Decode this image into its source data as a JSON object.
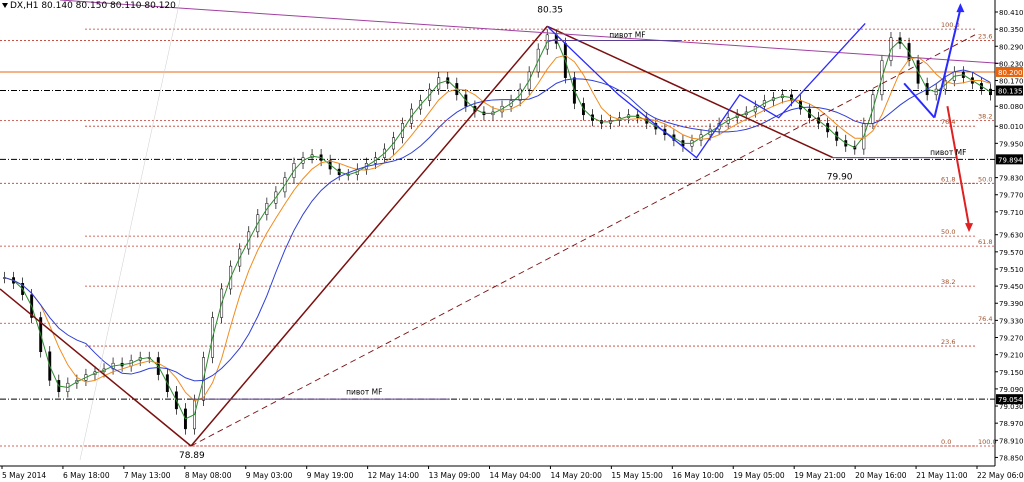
{
  "header": {
    "symbol": "DX,H1",
    "ohlc": "80.140 80.150 80.110 80.120"
  },
  "chart_data": {
    "type": "candlestick",
    "title": "DX,H1",
    "ylim": [
      78.82,
      80.452
    ],
    "x_ticks": [
      "5 May 2014",
      "6 May 18:00",
      "7 May 13:00",
      "8 May 08:00",
      "9 May 03:00",
      "9 May 19:00",
      "12 May 14:00",
      "13 May 09:00",
      "14 May 04:00",
      "14 May 20:00",
      "15 May 15:00",
      "16 May 10:00",
      "19 May 05:00",
      "19 May 21:00",
      "20 May 16:00",
      "21 May 11:00",
      "22 May 06:00"
    ],
    "y_ticks": [
      "80.410",
      "80.350",
      "80.290",
      "80.230",
      "80.170",
      "80.080",
      "80.010",
      "79.950",
      "79.830",
      "79.770",
      "79.710",
      "79.630",
      "79.570",
      "79.510",
      "79.450",
      "79.390",
      "79.330",
      "79.270",
      "79.210",
      "79.150",
      "79.090",
      "79.030",
      "78.970",
      "78.910",
      "78.850"
    ],
    "price_markers": [
      {
        "label": "80.200",
        "color": "#e8640c"
      },
      {
        "label": "80.135",
        "color": "#000000"
      },
      {
        "label": "79.894",
        "color": "#000000"
      },
      {
        "label": "79.054",
        "color": "#000000"
      }
    ],
    "horizontal_lines": [
      {
        "price": 80.2,
        "style": "solid",
        "color": "#e8640c"
      },
      {
        "price": 80.135,
        "style": "dashdot",
        "color": "#000000"
      },
      {
        "price": 79.894,
        "style": "dashdot",
        "color": "#000000"
      },
      {
        "price": 79.054,
        "style": "dashdot",
        "color": "#000000"
      }
    ],
    "fib_retracement_1": {
      "color": "#c0392b",
      "levels": [
        {
          "label": "100.0",
          "price": 80.35
        },
        {
          "label": "76.4",
          "price": 80.01
        },
        {
          "label": "61.8",
          "price": 79.81
        },
        {
          "label": "50.0",
          "price": 79.625
        },
        {
          "label": "38.2",
          "price": 79.45
        },
        {
          "label": "23.6",
          "price": 79.24
        },
        {
          "label": "0.0",
          "price": 78.89
        }
      ]
    },
    "fib_retracement_2": {
      "color": "#c0392b",
      "levels": [
        {
          "label": "23.6",
          "price": 80.31
        },
        {
          "label": "38.2",
          "price": 80.03
        },
        {
          "label": "50.0",
          "price": 79.81
        },
        {
          "label": "61.8",
          "price": 79.59
        },
        {
          "label": "76.4",
          "price": 79.32
        },
        {
          "label": "100.0",
          "price": 78.89
        }
      ]
    },
    "annotations": [
      {
        "text": "80.35",
        "x": "14 May 20:00",
        "price": 80.35
      },
      {
        "text": "79.90",
        "x": "20 May 16:00",
        "price": 79.9
      },
      {
        "text": "78.89",
        "x": "8 May 08:00",
        "price": 78.89
      },
      {
        "text": "пивот MF",
        "x": "15 May 15:00",
        "price": 80.33
      },
      {
        "text": "пивот MF",
        "x": "21 May 11:00",
        "price": 79.9
      },
      {
        "text": "пивот MF",
        "x": "9 May 19:00",
        "price": 79.054
      }
    ],
    "pattern_points": {
      "low_1": {
        "x_index": 88.3,
        "price": 78.89
      },
      "high_1": {
        "x_index": 253,
        "price": 80.36
      },
      "low_2": {
        "x_index": 385,
        "price": 79.9
      },
      "forecast_up": {
        "x_index": 444,
        "price": 80.42
      },
      "forecast_down": {
        "x_index": 448,
        "price": 79.66
      }
    },
    "series": [
      {
        "name": "Close",
        "type": "candlestick",
        "color": "#000000",
        "values": [
          79.48,
          79.46,
          79.42,
          79.34,
          79.22,
          79.12,
          79.08,
          79.11,
          79.12,
          79.14,
          79.15,
          79.16,
          79.18,
          79.17,
          79.19,
          79.2,
          79.2,
          79.14,
          79.08,
          79.02,
          78.95,
          79.05,
          79.2,
          79.34,
          79.44,
          79.52,
          79.58,
          79.64,
          79.7,
          79.74,
          79.78,
          79.83,
          79.88,
          79.9,
          79.91,
          79.89,
          79.86,
          79.84,
          79.84,
          79.86,
          79.88,
          79.9,
          79.93,
          79.97,
          80.02,
          80.07,
          80.1,
          80.14,
          80.18,
          80.16,
          80.12,
          80.08,
          80.06,
          80.05,
          80.06,
          80.08,
          80.1,
          80.14,
          80.2,
          80.28,
          80.33,
          80.3,
          80.18,
          80.09,
          80.05,
          80.03,
          80.02,
          80.03,
          80.04,
          80.05,
          80.04,
          80.02,
          80.0,
          79.98,
          79.96,
          79.94,
          79.96,
          79.98,
          80.0,
          80.02,
          80.04,
          80.05,
          80.06,
          80.08,
          80.1,
          80.11,
          80.12,
          80.1,
          80.07,
          80.04,
          80.02,
          79.99,
          79.96,
          79.94,
          79.93,
          80.02,
          80.12,
          80.24,
          80.32,
          80.3,
          80.24,
          80.16,
          80.12,
          80.14,
          80.17,
          80.2,
          80.18,
          80.16,
          80.14,
          80.12
        ]
      },
      {
        "name": "MA fast",
        "type": "line",
        "color": "#2e8b2e"
      },
      {
        "name": "MA medium",
        "type": "line",
        "color": "#f08c1e"
      },
      {
        "name": "MA slow",
        "type": "line",
        "color": "#2f3fd6"
      }
    ]
  }
}
